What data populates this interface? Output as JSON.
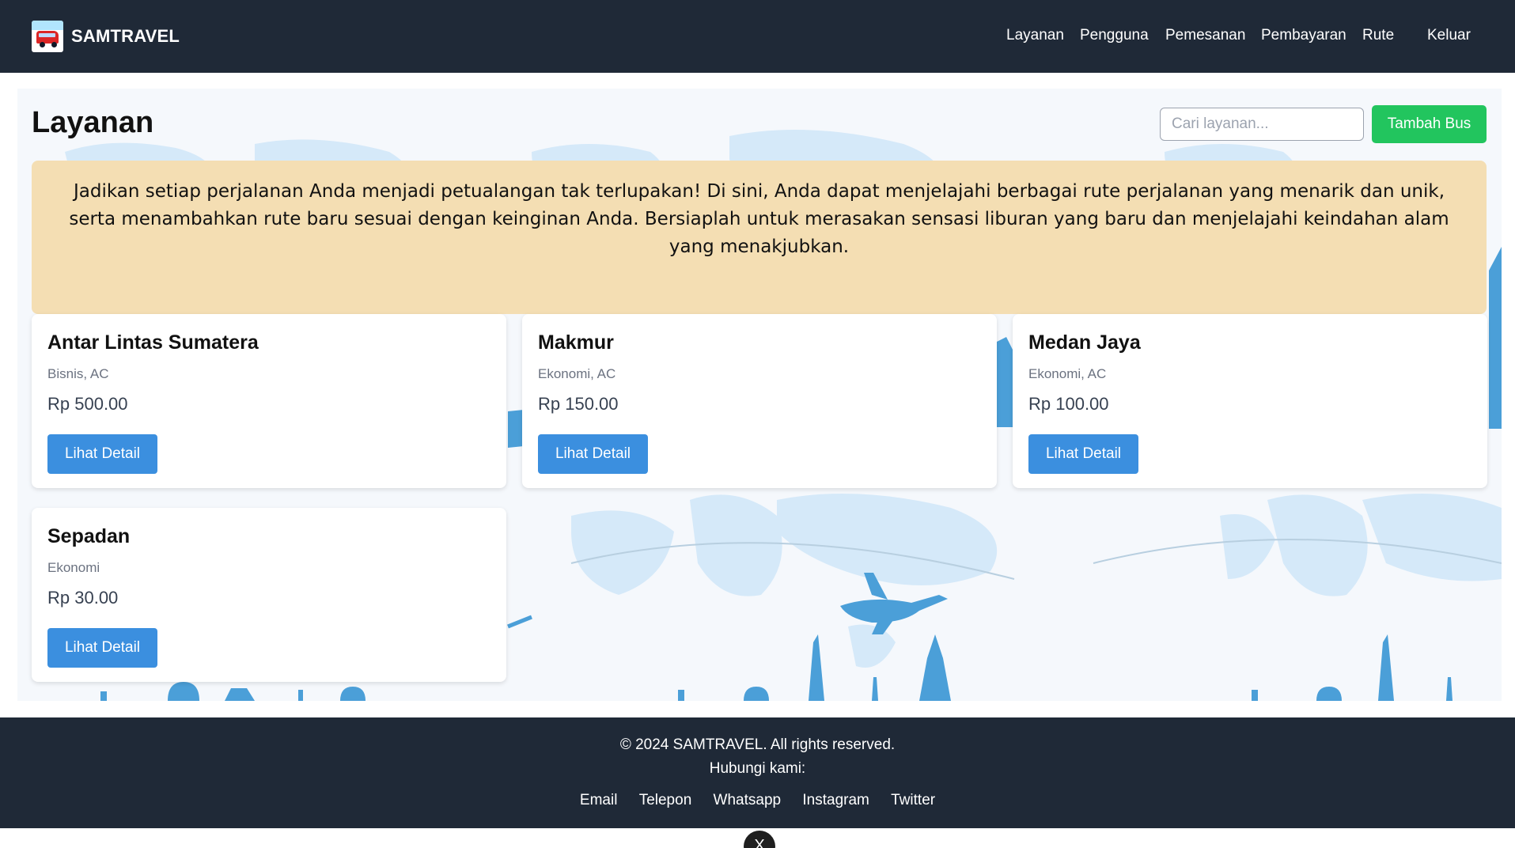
{
  "brand": {
    "name": "SAMTRAVEL",
    "logo_icon": "bus-logo-icon"
  },
  "nav": {
    "items": [
      "Layanan",
      "Pengguna",
      "Pemesanan",
      "Pembayaran",
      "Rute"
    ],
    "logout": "Keluar"
  },
  "page": {
    "title": "Layanan",
    "search_placeholder": "Cari layanan...",
    "add_button": "Tambah Bus",
    "banner": "Jadikan setiap perjalanan Anda menjadi petualangan tak terlupakan! Di sini, Anda dapat menjelajahi berbagai rute perjalanan yang menarik dan unik, serta menambahkan rute baru sesuai dengan keinginan Anda. Bersiaplah untuk merasakan sensasi liburan yang baru dan menjelajahi keindahan alam yang menakjubkan."
  },
  "services": [
    {
      "name": "Antar Lintas Sumatera",
      "class": "Bisnis, AC",
      "price": "Rp 500.00",
      "button": "Lihat Detail"
    },
    {
      "name": "Makmur",
      "class": "Ekonomi, AC",
      "price": "Rp 150.00",
      "button": "Lihat Detail"
    },
    {
      "name": "Medan Jaya",
      "class": "Ekonomi, AC",
      "price": "Rp 100.00",
      "button": "Lihat Detail"
    },
    {
      "name": "Sepadan",
      "class": "Ekonomi",
      "price": "Rp 30.00",
      "button": "Lihat Detail"
    }
  ],
  "footer": {
    "copyright": "© 2024 SAMTRAVEL. All rights reserved.",
    "contact": "Hubungi kami:",
    "links": [
      "Email",
      "Telepon",
      "Whatsapp",
      "Instagram",
      "Twitter"
    ]
  },
  "floating_button": {
    "label": "X",
    "icon": "close-icon"
  },
  "colors": {
    "navbar": "#1f2937",
    "banner": "#f4deb3",
    "add_button": "#22c55e",
    "detail_button": "#3b8fdf",
    "map": "#cfe6f8",
    "landmark": "#4b9fd8"
  }
}
